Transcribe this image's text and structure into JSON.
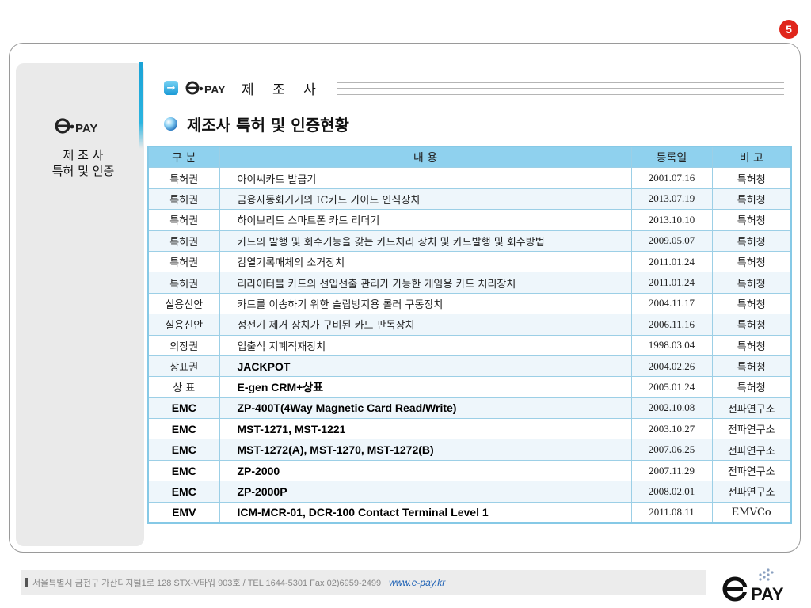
{
  "page_number": "5",
  "brand_logo": "e·PAY",
  "left_panel": {
    "title_line1": "제 조 사",
    "title_line2": "특허 및 인증"
  },
  "header": {
    "title": "제 조 사",
    "subtitle": "제조사 특허 및 인증현황"
  },
  "table": {
    "headers": [
      "구 분",
      "내  용",
      "등록일",
      "비  고"
    ],
    "rows": [
      {
        "category": "특허권",
        "content": "아이씨카드 발급기",
        "date": "2001.07.16",
        "note": "특허청",
        "bold": false
      },
      {
        "category": "특허권",
        "content": "금융자동화기기의 IC카드 가이드 인식장치",
        "date": "2013.07.19",
        "note": "특허청",
        "bold": false
      },
      {
        "category": "특허권",
        "content": " 하이브리드 스마트폰 카드 리더기",
        "date": "2013.10.10",
        "note": "특허청",
        "bold": false
      },
      {
        "category": "특허권",
        "content": "카드의 발행 및 회수기능을 갖는 카드처리 장치 및 카드발행 및 회수방법",
        "date": "2009.05.07",
        "note": "특허청",
        "bold": false
      },
      {
        "category": "특허권",
        "content": "감열기록매체의 소거장치",
        "date": "2011.01.24",
        "note": "특허청",
        "bold": false
      },
      {
        "category": "특허권",
        "content": "리라이터블 카드의 선입선출 관리가 가능한 게임용 카드 처리장치",
        "date": "2011.01.24",
        "note": "특허청",
        "bold": false
      },
      {
        "category": "실용신안",
        "content": "카드를 이송하기 위한 슬립방지용 롤러 구동장치",
        "date": "2004.11.17",
        "note": "특허청",
        "bold": false
      },
      {
        "category": "실용신안",
        "content": "정전기 제거 장치가 구비된 카드 판독장치",
        "date": "2006.11.16",
        "note": "특허청",
        "bold": false
      },
      {
        "category": "의장권",
        "content": "입출식 지폐적재장치",
        "date": "1998.03.04",
        "note": "특허청",
        "bold": false
      },
      {
        "category": "상표권",
        "content": "JACKPOT",
        "date": "2004.02.26",
        "note": "특허청",
        "bold": false,
        "content_bold": true
      },
      {
        "category": "상  표",
        "content": "E-gen CRM+상표",
        "date": "2005.01.24",
        "note": "특허청",
        "bold": false,
        "content_bold": true
      },
      {
        "category": "EMC",
        "content": "ZP-400T(4Way Magnetic Card Read/Write)",
        "date": "2002.10.08",
        "note": "전파연구소",
        "bold": true
      },
      {
        "category": "EMC",
        "content": "MST-1271, MST-1221",
        "date": "2003.10.27",
        "note": "전파연구소",
        "bold": true
      },
      {
        "category": "EMC",
        "content": "MST-1272(A), MST-1270, MST-1272(B)",
        "date": "2007.06.25",
        "note": "전파연구소",
        "bold": true
      },
      {
        "category": "EMC",
        "content": "ZP-2000",
        "date": "2007.11.29",
        "note": "전파연구소",
        "bold": true
      },
      {
        "category": "EMC",
        "content": "ZP-2000P",
        "date": "2008.02.01",
        "note": "전파연구소",
        "bold": true
      },
      {
        "category": "EMV",
        "content": "ICM-MCR-01, DCR-100 Contact Terminal Level 1",
        "date": "2011.08.11",
        "note": "EMVCo",
        "bold": true
      }
    ]
  },
  "footer": {
    "address": "서울특별시 금천구 가산디지털1로 128 STX-V타워 903호 /  TEL 1644-5301 Fax 02)6959-2499",
    "url": "www.e-pay.kr"
  },
  "colors": {
    "accent": "#1aa2d6",
    "header_bg": "#8fd1ee",
    "badge": "#e0261b"
  }
}
